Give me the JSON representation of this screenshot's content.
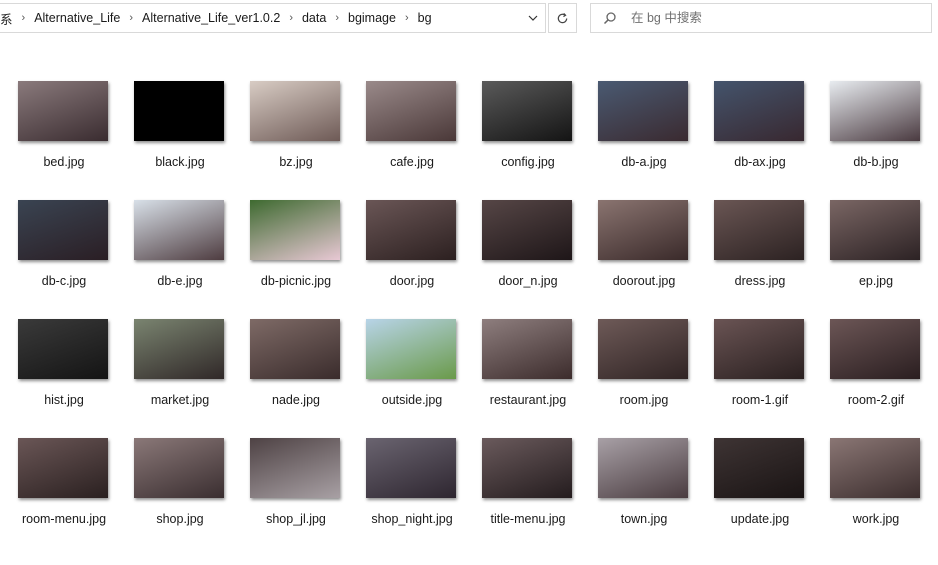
{
  "address": {
    "segments": [
      "系",
      "Alternative_Life",
      "Alternative_Life_ver1.0.2",
      "data",
      "bgimage",
      "bg"
    ]
  },
  "search": {
    "placeholder": "在 bg 中搜索"
  },
  "icons": {
    "dropdown": "chevron-down-icon",
    "refresh": "refresh-icon",
    "search": "search-icon"
  },
  "files": [
    {
      "name": "bed.jpg",
      "colors": [
        "#8a7a7c",
        "#3a2c30"
      ]
    },
    {
      "name": "black.jpg",
      "colors": [
        "#000000",
        "#000000"
      ]
    },
    {
      "name": "bz.jpg",
      "colors": [
        "#d8ccc4",
        "#6e5a56"
      ]
    },
    {
      "name": "cafe.jpg",
      "colors": [
        "#9a8a8a",
        "#4a3838"
      ]
    },
    {
      "name": "config.jpg",
      "colors": [
        "#5a5a5a",
        "#141414"
      ]
    },
    {
      "name": "db-a.jpg",
      "colors": [
        "#4a5a72",
        "#3a2a30"
      ]
    },
    {
      "name": "db-ax.jpg",
      "colors": [
        "#44546c",
        "#382830"
      ]
    },
    {
      "name": "db-b.jpg",
      "colors": [
        "#e8ecf0",
        "#4a3a40"
      ]
    },
    {
      "name": "db-c.jpg",
      "colors": [
        "#3a4452",
        "#2a1e24"
      ]
    },
    {
      "name": "db-e.jpg",
      "colors": [
        "#d8e0e8",
        "#4e3c40"
      ]
    },
    {
      "name": "db-picnic.jpg",
      "colors": [
        "#3e6a30",
        "#e8c8d4"
      ]
    },
    {
      "name": "door.jpg",
      "colors": [
        "#6a5656",
        "#2c2020"
      ]
    },
    {
      "name": "door_n.jpg",
      "colors": [
        "#564646",
        "#1e1618"
      ]
    },
    {
      "name": "doorout.jpg",
      "colors": [
        "#8a7470",
        "#3a2a2a"
      ]
    },
    {
      "name": "dress.jpg",
      "colors": [
        "#6a5654",
        "#2c2222"
      ]
    },
    {
      "name": "ep.jpg",
      "colors": [
        "#7a6664",
        "#2c2224"
      ]
    },
    {
      "name": "hist.jpg",
      "colors": [
        "#3a3a3a",
        "#141414"
      ]
    },
    {
      "name": "market.jpg",
      "colors": [
        "#7a8470",
        "#302828"
      ]
    },
    {
      "name": "nade.jpg",
      "colors": [
        "#7e6a66",
        "#3a2c2c"
      ]
    },
    {
      "name": "outside.jpg",
      "colors": [
        "#b8d4e8",
        "#6a9a4a"
      ]
    },
    {
      "name": "restaurant.jpg",
      "colors": [
        "#8e7e7e",
        "#3c2c2c"
      ]
    },
    {
      "name": "room.jpg",
      "colors": [
        "#6e5a58",
        "#302424"
      ]
    },
    {
      "name": "room-1.gif",
      "colors": [
        "#6a5454",
        "#2a2020"
      ]
    },
    {
      "name": "room-2.gif",
      "colors": [
        "#6c5656",
        "#2a1e20"
      ]
    },
    {
      "name": "room-menu.jpg",
      "colors": [
        "#6a5656",
        "#2a2020"
      ]
    },
    {
      "name": "shop.jpg",
      "colors": [
        "#8a7878",
        "#3a2e30"
      ]
    },
    {
      "name": "shop_jl.jpg",
      "colors": [
        "#4e4244",
        "#a8a0a4"
      ]
    },
    {
      "name": "shop_night.jpg",
      "colors": [
        "#6a6470",
        "#2e2630"
      ]
    },
    {
      "name": "title-menu.jpg",
      "colors": [
        "#6a5a5c",
        "#241c1e"
      ]
    },
    {
      "name": "town.jpg",
      "colors": [
        "#a8a0a6",
        "#4a3c40"
      ]
    },
    {
      "name": "update.jpg",
      "colors": [
        "#3e3434",
        "#1a1414"
      ]
    },
    {
      "name": "work.jpg",
      "colors": [
        "#8a7674",
        "#3c2e2e"
      ]
    }
  ]
}
